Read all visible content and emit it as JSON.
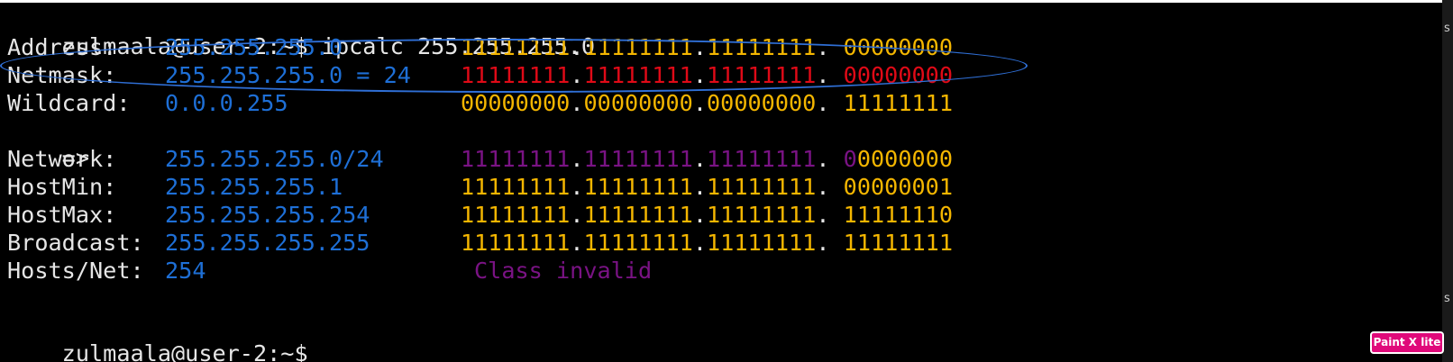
{
  "terminal": {
    "prompt_command": "zulmaala@user-2:~$ ipcalc 255.255.255.0",
    "final_prompt": "zulmaala@user-2:~$ ",
    "arrow": "=>",
    "rows": {
      "address": {
        "label": "Address:",
        "value": "255.255.255.0",
        "b1": "11111111",
        "d1": ".",
        "b2": "11111111",
        "d2": ".",
        "b3": "11111111",
        "d3": ". ",
        "b4": "00000000"
      },
      "netmask": {
        "label": "Netmask:",
        "value": "255.255.255.0 = 24",
        "b1": "11111111",
        "d1": ".",
        "b2": "11111111",
        "d2": ".",
        "b3": "11111111",
        "d3": ". ",
        "b4": "00000000"
      },
      "wildcard": {
        "label": "Wildcard:",
        "value": "0.0.0.255",
        "b1": "00000000",
        "d1": ".",
        "b2": "00000000",
        "d2": ".",
        "b3": "00000000",
        "d3": ". ",
        "b4": "11111111"
      },
      "network": {
        "label": "Network:",
        "value": "255.255.255.0/24",
        "b1": "11111111",
        "d1": ".",
        "b2": "11111111",
        "d2": ".",
        "b3": "11111111",
        "d3": ". ",
        "b4a": "0",
        "b4b": "0000000"
      },
      "hostmin": {
        "label": "HostMin:",
        "value": "255.255.255.1",
        "b1": "11111111",
        "d1": ".",
        "b2": "11111111",
        "d2": ".",
        "b3": "11111111",
        "d3": ". ",
        "b4": "00000001"
      },
      "hostmax": {
        "label": "HostMax:",
        "value": "255.255.255.254",
        "b1": "11111111",
        "d1": ".",
        "b2": "11111111",
        "d2": ".",
        "b3": "11111111",
        "d3": ". ",
        "b4": "11111110"
      },
      "broadcast": {
        "label": "Broadcast:",
        "value": "255.255.255.255",
        "b1": "11111111",
        "d1": ".",
        "b2": "11111111",
        "d2": ".",
        "b3": "11111111",
        "d3": ". ",
        "b4": "11111111"
      },
      "hostsnet": {
        "label": "Hosts/Net:",
        "value": "254",
        "class_text": "Class invalid"
      }
    }
  },
  "overlay": {
    "badge_label": "Paint X lite"
  },
  "colors": {
    "background": "#000000",
    "text": "#e6e6e6",
    "value_blue": "#1e6fd6",
    "binary_yellow": "#f4b600",
    "netmask_red": "#e00a17",
    "network_purple": "#7a1384",
    "annotation_blue": "#2f6fd6",
    "badge_pink": "#e0097a"
  }
}
